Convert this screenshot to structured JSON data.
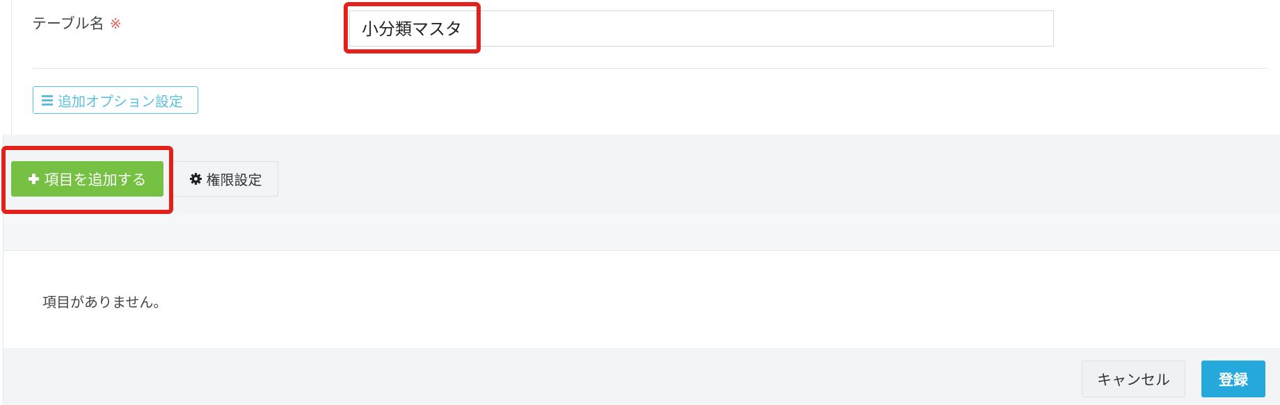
{
  "form": {
    "table_name_label": "テーブル名",
    "required_mark": "※",
    "table_name_value": "小分類マスタ",
    "option_button_label": "追加オプション設定"
  },
  "toolbar": {
    "add_item_label": "項目を追加する",
    "permission_label": "権限設定"
  },
  "list": {
    "empty_message": "項目がありません。"
  },
  "footer": {
    "cancel_label": "キャンセル",
    "submit_label": "登録"
  },
  "colors": {
    "add_button": "#76c043",
    "submit_button": "#25a9dc",
    "option_outline": "#5bc0de",
    "highlight": "#e4201a",
    "required_mark": "#e8594f"
  },
  "icons": {
    "option_button": "hamburger-icon",
    "add_button": "plus-icon",
    "permission_button": "gear-icon"
  }
}
